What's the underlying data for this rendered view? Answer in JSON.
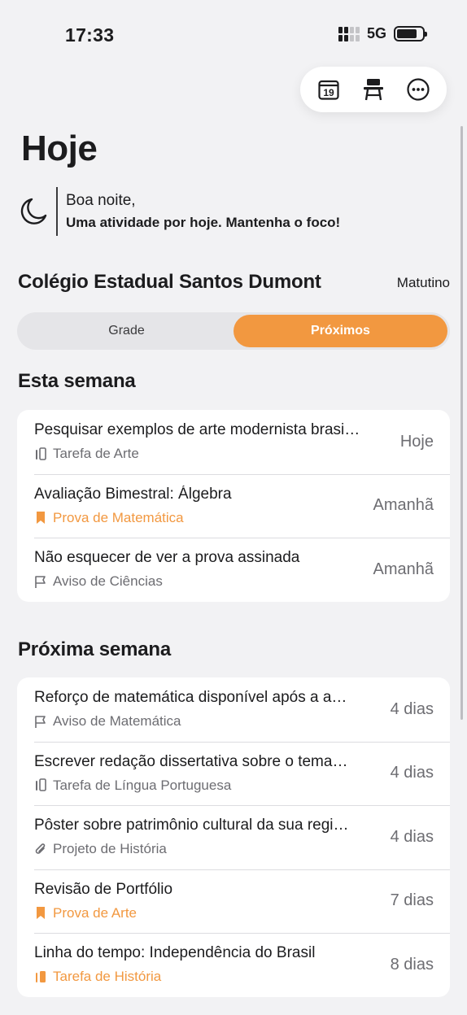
{
  "status_bar": {
    "time": "17:33",
    "network": "5G"
  },
  "toolbar": {
    "calendar_day": "19"
  },
  "page": {
    "title": "Hoje",
    "greeting": "Boa noite,",
    "message": "Uma atividade por hoje. Mantenha o foco!"
  },
  "school": {
    "name": "Colégio Estadual Santos Dumont",
    "shift": "Matutino"
  },
  "tabs": {
    "grade": "Grade",
    "upcoming": "Próximos"
  },
  "this_week": {
    "title": "Esta semana",
    "items": [
      {
        "title": "Pesquisar exemplos de arte modernista brasi…",
        "type": "Tarefa de Arte",
        "icon": "book-icon",
        "when": "Hoje"
      },
      {
        "title": "Avaliação Bimestral: Álgebra",
        "type": "Prova de Matemática",
        "icon": "bookmark-icon",
        "when": "Amanhã"
      },
      {
        "title": "Não esquecer de ver a prova assinada",
        "type": "Aviso de Ciências",
        "icon": "flag-icon",
        "when": "Amanhã"
      }
    ]
  },
  "next_week": {
    "title": "Próxima semana",
    "items": [
      {
        "title": "Reforço de matemática disponível após a a…",
        "type": "Aviso de Matemática",
        "icon": "flag-icon",
        "when": "4 dias"
      },
      {
        "title": "Escrever redação dissertativa sobre o tema…",
        "type": "Tarefa de Língua Portuguesa",
        "icon": "book-icon",
        "when": "4 dias"
      },
      {
        "title": "Pôster sobre patrimônio cultural da sua regi…",
        "type": "Projeto de História",
        "icon": "paperclip-icon",
        "when": "4 dias"
      },
      {
        "title": "Revisão de Portfólio",
        "type": "Prova de Arte",
        "icon": "bookmark-icon",
        "when": "7 dias"
      },
      {
        "title": "Linha do tempo: Independência do Brasil",
        "type": "Tarefa de História",
        "icon": "book-icon",
        "when": "8 dias"
      }
    ]
  },
  "colors": {
    "accent": "#f29840",
    "background": "#f2f2f4",
    "secondary_text": "#6d6d72"
  }
}
